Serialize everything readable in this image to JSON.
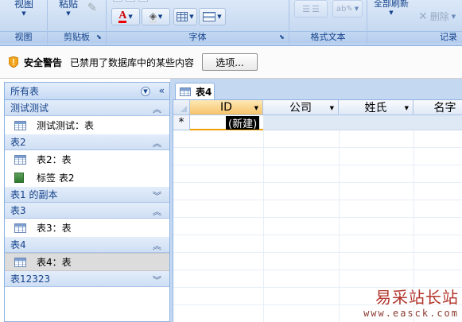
{
  "ribbon": {
    "groups": [
      {
        "label": "视图",
        "button": "视图"
      },
      {
        "label": "剪贴板",
        "button": "粘贴"
      },
      {
        "label": "字体"
      },
      {
        "label": "格式文本"
      },
      {
        "label": "记录",
        "refresh": "全部刷新",
        "delete": "删除"
      }
    ]
  },
  "security": {
    "title": "安全警告",
    "message": "已禁用了数据库中的某些内容",
    "button": "选项..."
  },
  "nav": {
    "header": "所有表",
    "groups": [
      {
        "title": "测试测试",
        "items": [
          {
            "label": "测试测试：表",
            "kind": "table"
          }
        ]
      },
      {
        "title": "表2",
        "items": [
          {
            "label": "表2：表",
            "kind": "table"
          },
          {
            "label": "标签 表2",
            "kind": "report"
          }
        ]
      },
      {
        "title": "表1 的副本",
        "items": []
      },
      {
        "title": "表3",
        "items": [
          {
            "label": "表3：表",
            "kind": "table"
          }
        ]
      },
      {
        "title": "表4",
        "items": [
          {
            "label": "表4：表",
            "kind": "table",
            "selected": true
          }
        ]
      },
      {
        "title": "表12323",
        "items": []
      }
    ]
  },
  "document": {
    "tab": "表4",
    "columns": [
      "ID",
      "公司",
      "姓氏",
      "名字"
    ],
    "new_row_marker": "*",
    "new_row_text": "(新建)"
  },
  "watermark": {
    "text": "易采站长站",
    "url": "www.easck.com"
  },
  "colors": {
    "ribbon": "#c9dbf2",
    "active_header": "#f7c36a",
    "watermark": "#b2342a"
  }
}
